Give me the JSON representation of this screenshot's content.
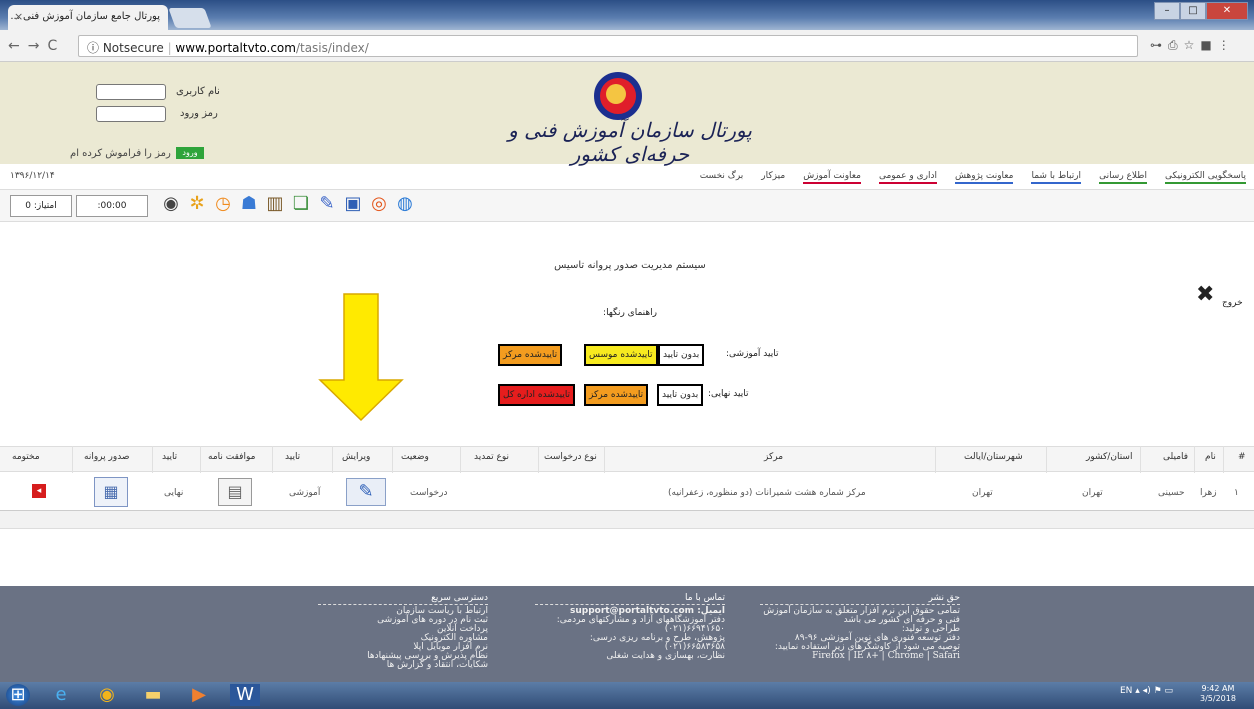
{
  "browser": {
    "tab_title": "پورتال جامع سازمان آموزش فنی ...",
    "tab_close": "×",
    "address_secure": "ⓘ Notsecure",
    "address_host": "www.portaltvto.com",
    "address_path": "/tasis/index/"
  },
  "header": {
    "site_title": "پورتال سازمان آموزش فنی و حرفه‌ای کشور",
    "username_label": "نام کاربری",
    "password_label": "رمز ورود",
    "login_button": "ورود",
    "forgot_link": "رمز را فراموش کرده ام"
  },
  "menubar": {
    "date": "۱۳۹۶/۱۲/۱۴",
    "items": [
      "برگ نخست",
      "میزکار",
      "معاونت آموزش",
      "اداری و عمومی",
      "معاونت پژوهش",
      "ارتباط با شما",
      "اطلاع رسانی",
      "پاسخگویی الکترونیکی"
    ]
  },
  "toolbar": {
    "score": "امتیاز: 0",
    "timer": ":00:00"
  },
  "main": {
    "system_title": "سیستم مدیریت صدور پروانه تاسیس",
    "exit_label": "خروج",
    "guide_title": "راهنمای رنگها:",
    "edu_label": "تایید آموزشی:",
    "final_label": "تایید نهایی:",
    "legend_edu": [
      {
        "text": "بدون تایید",
        "color": "#ffffff"
      },
      {
        "text": "تاییدشده موسس",
        "color": "#f7ea1f"
      },
      {
        "text": "تاییدشده مرکز",
        "color": "#f39c1f"
      }
    ],
    "legend_final": [
      {
        "text": "بدون تایید",
        "color": "#ffffff"
      },
      {
        "text": "تاییدشده مرکز",
        "color": "#f39c1f"
      },
      {
        "text": "تاییدشده اداره کل",
        "color": "#e61d1d"
      }
    ]
  },
  "table": {
    "headers": [
      "#",
      "نام",
      "فامیلی",
      "استان/کشور",
      "شهرستان/ایالت",
      "مرکز",
      "نوع درخواست",
      "نوع تمدید",
      "وضعیت",
      "ویرایش",
      "تایید",
      "موافقت نامه",
      "تایید",
      "صدور پروانه",
      "مختومه"
    ],
    "row": {
      "index": "۱",
      "first_name": "زهرا",
      "last_name": "حسینی",
      "province": "تهران",
      "city": "تهران",
      "center": "مرکز شماره هشت شمیرانات (دو منظوره، زعفرانیه)",
      "status": "درخواست",
      "approval": "آموزشی",
      "final_approval": "نهایی"
    }
  },
  "footer": {
    "quick_title": "دسترسی سریع",
    "quick_items": [
      "ارتباط با ریاست سازمان",
      "ثبت نام در دوره های آموزشی",
      "پرداخت آنلاین",
      "مشاوره الکترونیک",
      "نرم افزار موبایل اپلا",
      "نظام پذیرش و بررسی پیشنهادها",
      "شکایات، انتقاد و گزارش ها"
    ],
    "contact_title": "تماس با ما",
    "contact_email": "ایمیل: support@portaltvto.com",
    "contact_lines": [
      "دفتر آموزشگاههای آزاد و مشارکتهای مردمی: ۶۶۹۴۱۶۵۰(۰۲۱)",
      "پژوهش، طرح و برنامه ریزی درسی: ۶۶۵۸۳۶۵۸(۰۲۱)",
      "نظارت، بهسازی و هدایت شغلی"
    ],
    "copyright_title": "حق نشر",
    "copyright_lines": [
      "تمامی حقوق این نرم افزار متعلق به سازمان آموزش فنی و حرفه ای کشور می باشد",
      "طراحی و تولید:",
      "دفتر توسعه فنوری های نوین آموزشی ۹۶-۸۹",
      "توصیه می شود از کاوشگرهای زیر استفاده نمایید:"
    ],
    "browsers": "Firefox | IE ۸+ | Chrome | Safari"
  },
  "taskbar": {
    "tray": "EN",
    "time": "9:42 AM",
    "date": "3/5/2018"
  }
}
